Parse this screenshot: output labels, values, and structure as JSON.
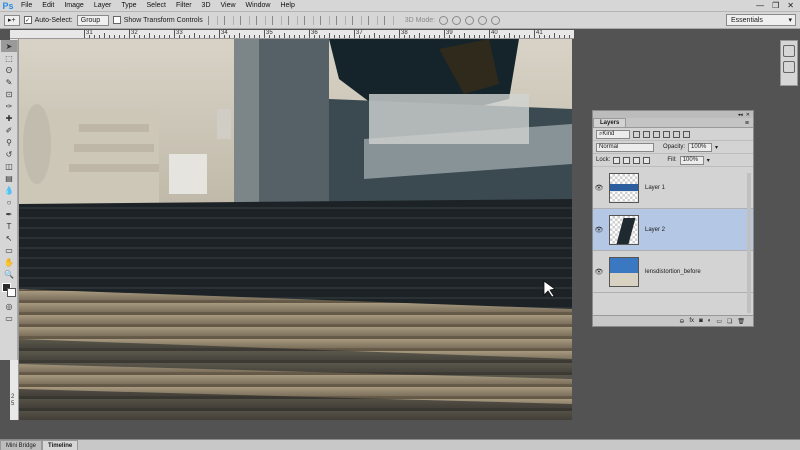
{
  "app": {
    "logo": "Ps"
  },
  "menu": [
    "File",
    "Edit",
    "Image",
    "Layer",
    "Type",
    "Select",
    "Filter",
    "3D",
    "View",
    "Window",
    "Help"
  ],
  "window_controls": [
    "—",
    "❐",
    "✕"
  ],
  "options": {
    "move_icon": "▸+",
    "auto_select_label": "Auto-Select:",
    "auto_select_checked": "✓",
    "group_value": "Group",
    "show_transform_label": "Show Transform Controls",
    "mode_label": "3D Mode:",
    "workspace": "Essentials"
  },
  "ruler": {
    "top_labels": [
      "31",
      "32",
      "33",
      "34",
      "35",
      "36",
      "37",
      "38",
      "39",
      "40",
      "41",
      "42",
      "43"
    ],
    "left_labels": [
      "2",
      "5"
    ]
  },
  "toolbar": {
    "tools": [
      "move-tool",
      "marquee-tool",
      "lasso-tool",
      "quick-select-tool",
      "crop-tool",
      "eyedropper-tool",
      "healing-tool",
      "brush-tool",
      "clone-stamp-tool",
      "history-brush-tool",
      "eraser-tool",
      "gradient-tool",
      "blur-tool",
      "dodge-tool",
      "pen-tool",
      "type-tool",
      "path-select-tool",
      "shape-tool",
      "hand-tool",
      "zoom-tool"
    ],
    "glyphs": [
      "➤",
      "⬚",
      "ʘ",
      "✎",
      "⊡",
      "✑",
      "✚",
      "✐",
      "⚲",
      "↺",
      "◫",
      "▤",
      "💧",
      "○",
      "✒",
      "T",
      "↖",
      "▭",
      "✋",
      "🔍"
    ]
  },
  "layers_panel": {
    "tab": "Layers",
    "kind_label": "Kind",
    "blend_mode": "Normal",
    "opacity_label": "Opacity:",
    "opacity_value": "100%",
    "lock_label": "Lock:",
    "fill_label": "Fill:",
    "fill_value": "100%",
    "layers": [
      {
        "name": "Layer 1",
        "selected": false
      },
      {
        "name": "Layer 2",
        "selected": true
      },
      {
        "name": "lensdistortion_before",
        "selected": false
      }
    ],
    "bottom_icons": [
      "link-icon",
      "fx-icon",
      "mask-icon",
      "adjustment-icon",
      "folder-icon",
      "new-layer-icon",
      "trash-icon"
    ],
    "bottom_glyphs": [
      "⊖",
      "fx",
      "◙",
      "◐",
      "▭",
      "❏",
      "🗑"
    ]
  },
  "bottom_tabs": [
    "Mini Bridge",
    "Timeline"
  ],
  "colors": {
    "accent": "#2a8be0",
    "selected": "#b4c8e6"
  }
}
